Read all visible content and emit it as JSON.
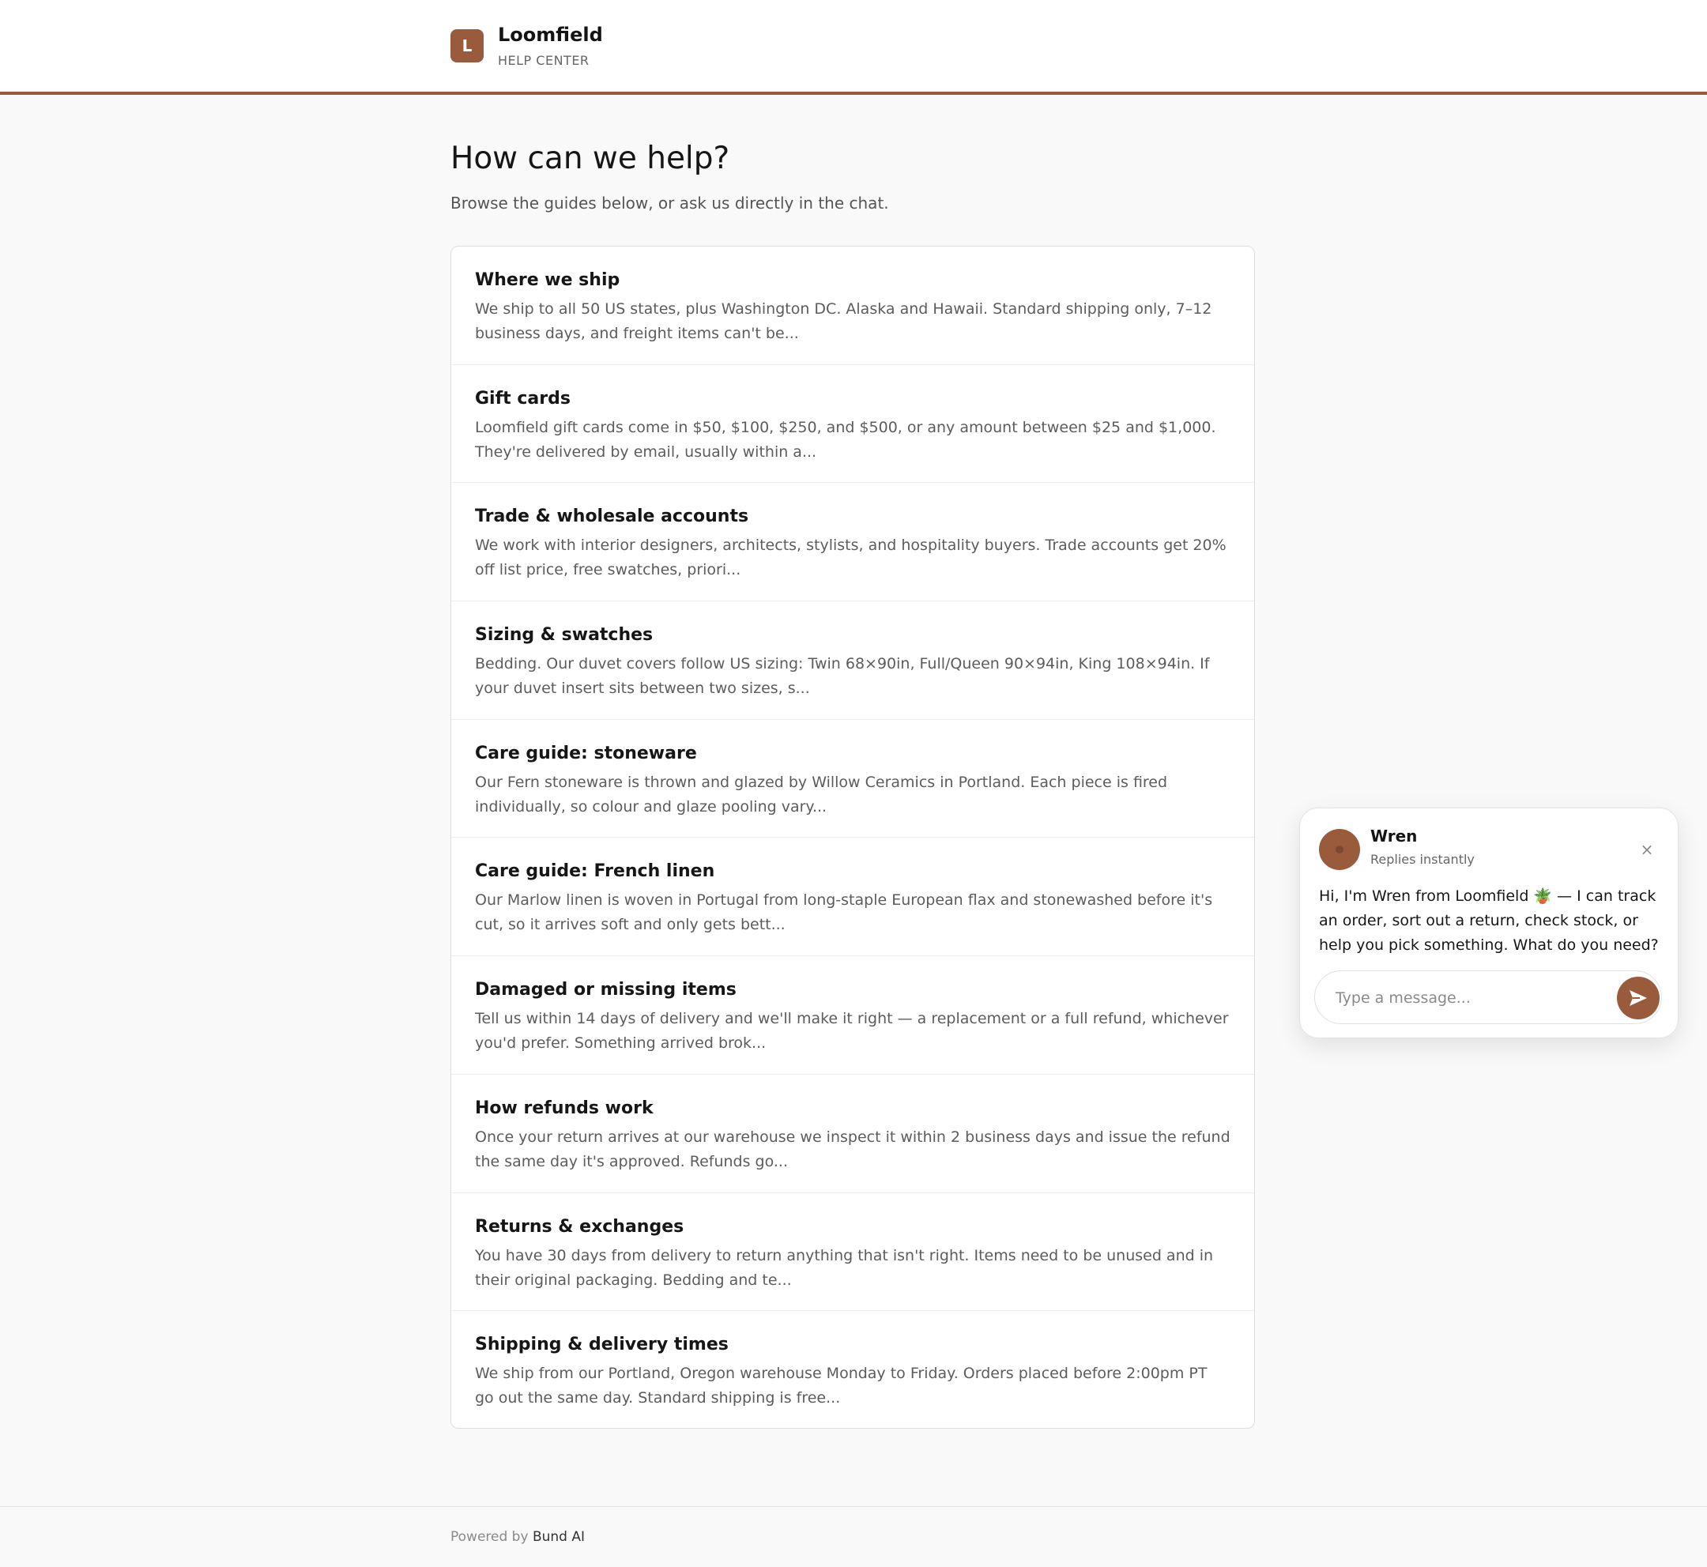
{
  "brand": {
    "logo_letter": "L",
    "name": "Loomfield",
    "subtitle": "HELP CENTER",
    "accent_color": "#9a5a3c"
  },
  "hero": {
    "title": "How can we help?",
    "subtitle": "Browse the guides below, or ask us directly in the chat."
  },
  "articles": [
    {
      "title": "Where we ship",
      "excerpt": "We ship to all 50 US states, plus Washington DC. Alaska and Hawaii. Standard shipping only, 7–12 business days, and freight items can't be..."
    },
    {
      "title": "Gift cards",
      "excerpt": "Loomfield gift cards come in $50, $100, $250, and $500, or any amount between $25 and $1,000. They're delivered by email, usually within a..."
    },
    {
      "title": "Trade & wholesale accounts",
      "excerpt": "We work with interior designers, architects, stylists, and hospitality buyers. Trade accounts get 20% off list price, free swatches, priori..."
    },
    {
      "title": "Sizing & swatches",
      "excerpt": "Bedding. Our duvet covers follow US sizing: Twin 68×90in, Full/Queen 90×94in, King 108×94in. If your duvet insert sits between two sizes, s..."
    },
    {
      "title": "Care guide: stoneware",
      "excerpt": "Our Fern stoneware is thrown and glazed by Willow Ceramics in Portland. Each piece is fired individually, so colour and glaze pooling vary..."
    },
    {
      "title": "Care guide: French linen",
      "excerpt": "Our Marlow linen is woven in Portugal from long-staple European flax and stonewashed before it's cut, so it arrives soft and only gets bett..."
    },
    {
      "title": "Damaged or missing items",
      "excerpt": "Tell us within 14 days of delivery and we'll make it right — a replacement or a full refund, whichever you'd prefer. Something arrived brok..."
    },
    {
      "title": "How refunds work",
      "excerpt": "Once your return arrives at our warehouse we inspect it within 2 business days and issue the refund the same day it's approved. Refunds go..."
    },
    {
      "title": "Returns & exchanges",
      "excerpt": "You have 30 days from delivery to return anything that isn't right. Items need to be unused and in their original packaging. Bedding and te..."
    },
    {
      "title": "Shipping & delivery times",
      "excerpt": "We ship from our Portland, Oregon warehouse Monday to Friday. Orders placed before 2:00pm PT go out the same day. Standard shipping is free..."
    }
  ],
  "chat": {
    "agent_name": "Wren",
    "agent_status": "Replies instantly",
    "close_icon": "×",
    "message": "Hi, I'm Wren from Loomfield 🪴 — I can track an order, sort out a return, check stock, or help you pick something. What do you need?",
    "input_placeholder": "Type a message...",
    "input_value": "",
    "send_icon": "send-icon"
  },
  "footer": {
    "prefix": "Powered by",
    "link": "Bund AI"
  }
}
